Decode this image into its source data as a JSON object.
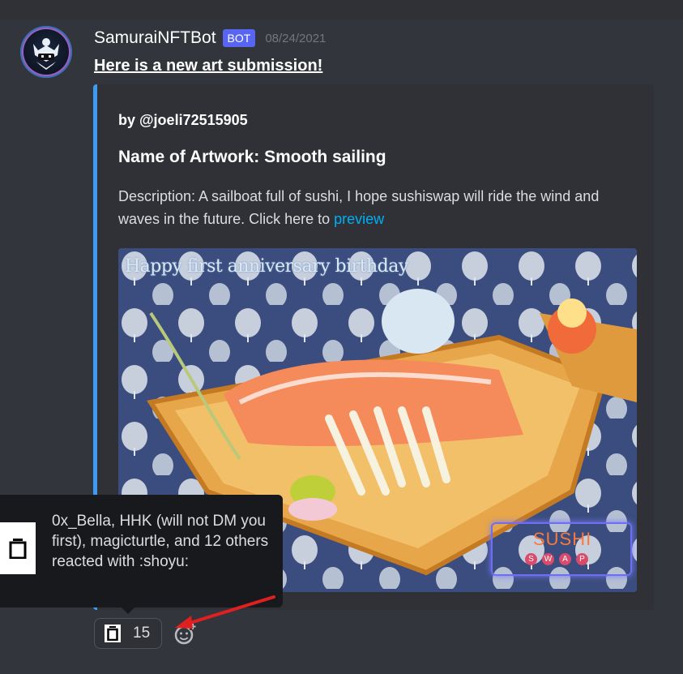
{
  "message": {
    "username": "SamuraiNFTBot",
    "bot_tag": "BOT",
    "timestamp": "08/24/2021",
    "headline": "Here is a new art submission!"
  },
  "embed": {
    "author": "by @joeli72515905",
    "title": "Name of Artwork: Smooth sailing",
    "description": "Description: A sailboat full of sushi, I hope sushiswap will ride the wind and waves in the future. Click here to ",
    "link_text": "preview",
    "accent_color": "#3d9bf2",
    "image": {
      "caption": "Happy first anniversary birthday",
      "brand_word": "SUSHI",
      "brand_sub": [
        "S",
        "W",
        "A",
        "P"
      ]
    }
  },
  "tooltip": {
    "text": "0x_Bella, HHK (will not DM you first), magicturtle, and 12 others reacted with :shoyu:",
    "emoji_icon": "shoyu-icon"
  },
  "reaction": {
    "emoji_icon": "shoyu-icon",
    "count": "15"
  },
  "add_reaction_icon": "add-reaction-icon",
  "annotation_color": "#e02020"
}
